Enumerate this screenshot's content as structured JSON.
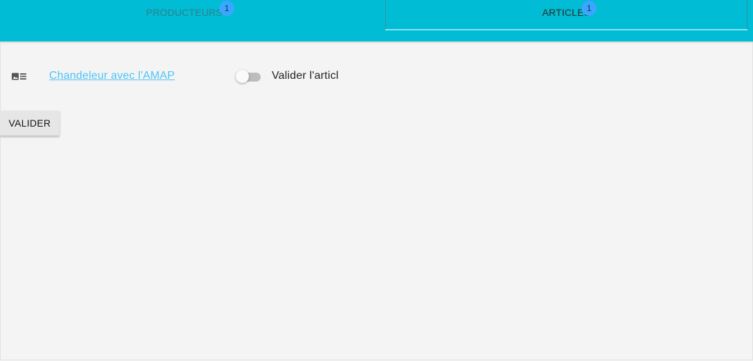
{
  "tabs": [
    {
      "label": "PRODUCTEURS",
      "badge": "1",
      "active": false
    },
    {
      "label": "ARTICLES",
      "badge": "1",
      "active": true
    }
  ],
  "article": {
    "icon": "article-card-icon",
    "title": "Chandeleur avec l'AMAP",
    "toggle_label": "Valider l'articl",
    "toggle_on": false
  },
  "actions": {
    "submit_label": "VALIDER"
  },
  "colors": {
    "tabbar": "#00bcd4",
    "badge": "#3aa6ff",
    "link": "#4fc3f7",
    "background": "#f4f4f4"
  }
}
